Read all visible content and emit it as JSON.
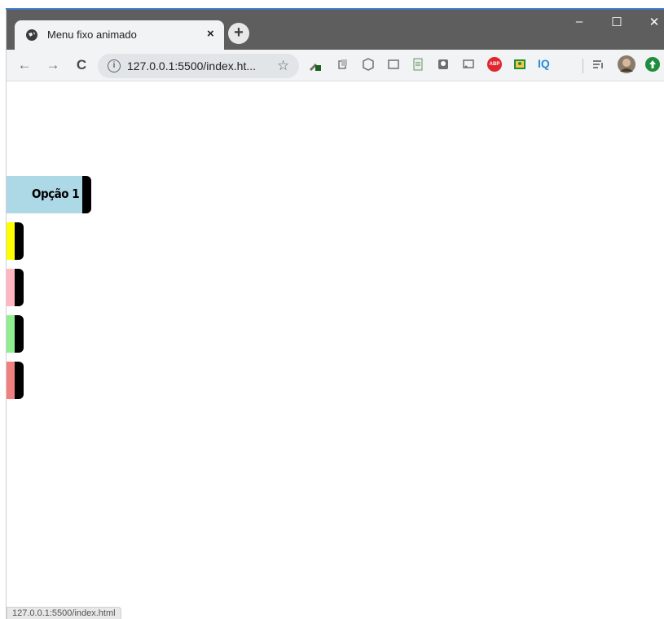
{
  "browser": {
    "tab_title": "Menu fixo animado",
    "tab_close": "×",
    "new_tab": "+",
    "window_controls": {
      "minimize": "–",
      "maximize": "☐",
      "close": "✕"
    },
    "nav": {
      "back": "←",
      "forward": "→",
      "reload": "C"
    },
    "address_bar": {
      "info": "i",
      "url": "127.0.0.1:5500/index.ht...",
      "star": "☆"
    },
    "extension_icons": [
      "eyedropper-icon",
      "copy-icon",
      "cube-icon",
      "screenshot-icon",
      "sheet-icon",
      "bulb-icon",
      "cast-icon",
      "abp-icon",
      "classroom-icon",
      "iq-icon",
      "reading-list-icon",
      "profile-avatar",
      "update-icon"
    ],
    "abp_label": "ABP",
    "iq_label": "IQ",
    "status_url": "127.0.0.1:5500/index.html"
  },
  "menu": {
    "items": [
      {
        "label": "Opção 1",
        "color": "#add8e6",
        "expanded": true
      },
      {
        "label": "",
        "color": "#ffff00",
        "expanded": false
      },
      {
        "label": "",
        "color": "#ffb6c1",
        "expanded": false
      },
      {
        "label": "",
        "color": "#90ee90",
        "expanded": false
      },
      {
        "label": "",
        "color": "#f08080",
        "expanded": false
      }
    ],
    "accent_color": "#000000"
  }
}
